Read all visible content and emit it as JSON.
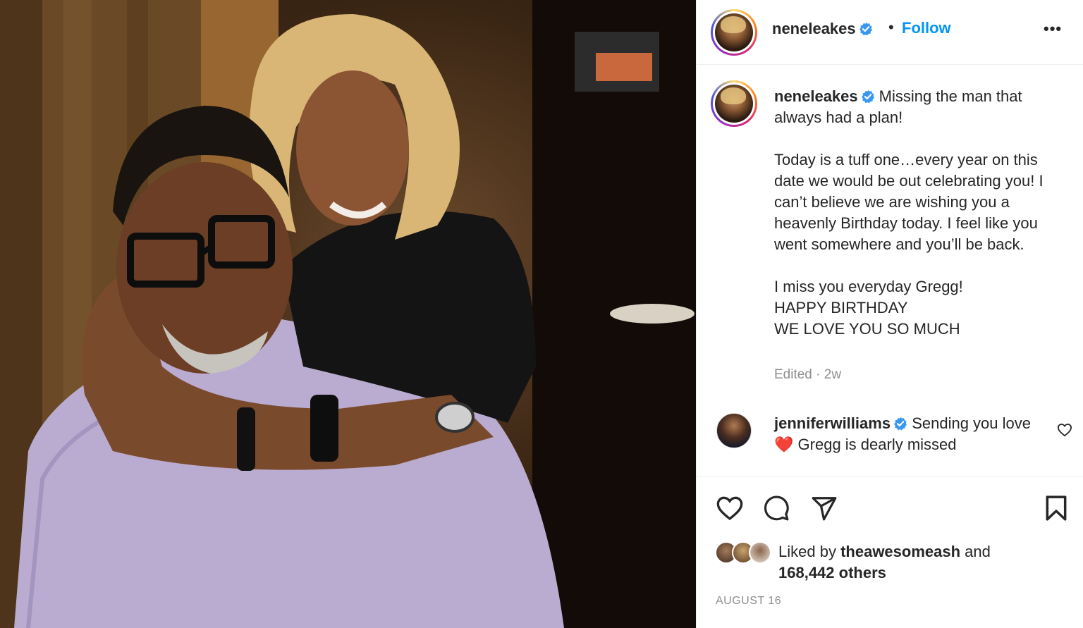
{
  "post": {
    "author": "neneleakes",
    "follow_label": "Follow",
    "separator": "•",
    "more_label": "•••"
  },
  "caption": {
    "author": "neneleakes",
    "text": "Missing the man that always had a plan!\n\nToday is a tuff one…every year on this date we would be out celebrating you! I can’t believe we are wishing you a heavenly Birthday today. I feel like you went somewhere and you’ll be back.\n\nI miss you everyday Gregg!\nHAPPY BIRTHDAY\nWE LOVE YOU SO MUCH",
    "meta": "Edited · 2w"
  },
  "comment": {
    "author": "jenniferwilliams",
    "text_before": "Sending you love",
    "emoji": "❤️",
    "text_after": "Gregg is dearly missed"
  },
  "likes": {
    "prefix": "Liked by",
    "top_liker": "theawesomeash",
    "middle": "and",
    "others": "168,442 others"
  },
  "date": "AUGUST 16",
  "colors": {
    "accent": "#0095f6",
    "verified": "#3897f0",
    "heart": "#ed4956",
    "muted": "#8e8e8e"
  },
  "icons": [
    "verified-badge-icon",
    "like-icon",
    "comment-icon",
    "share-icon",
    "save-icon",
    "comment-like-icon",
    "more-options-icon"
  ]
}
